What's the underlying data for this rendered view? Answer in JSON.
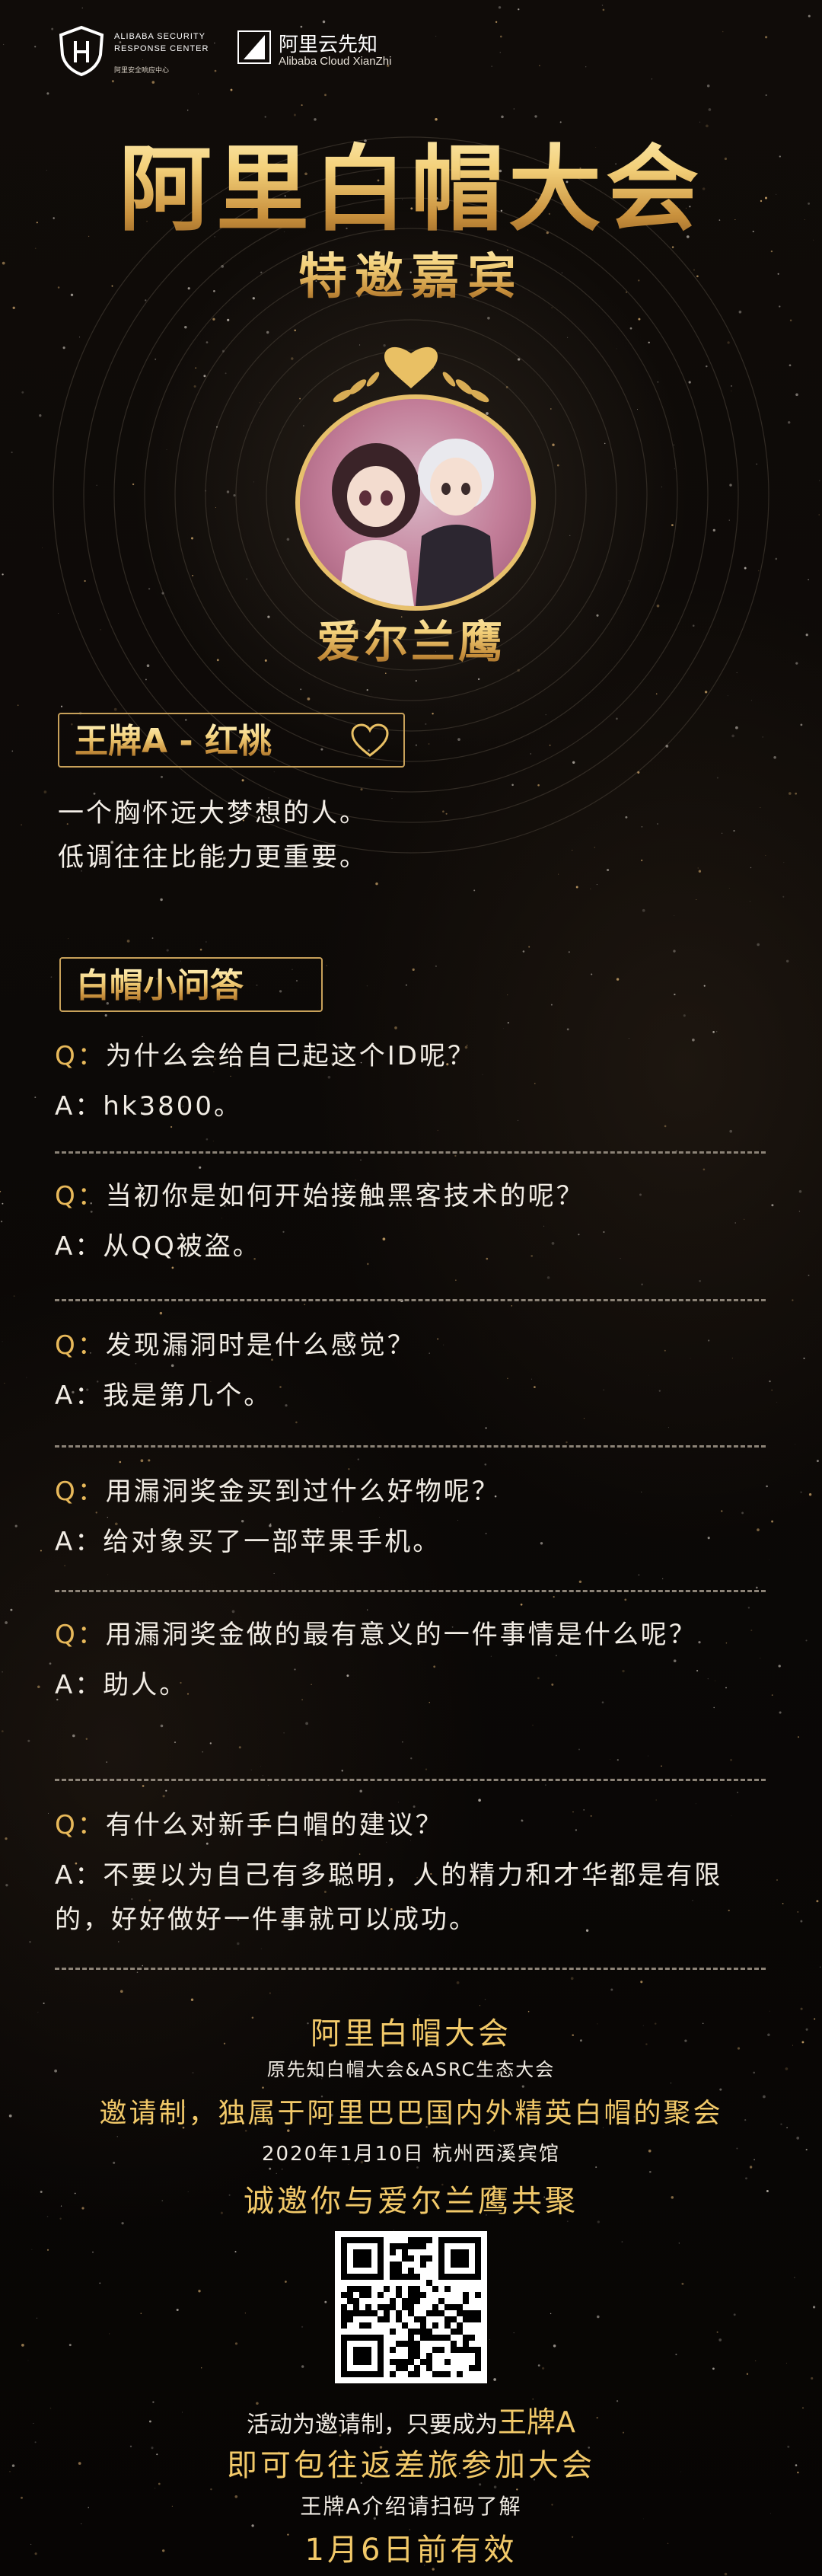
{
  "header": {
    "logo1_lines": [
      "ALIBABA SECURITY",
      "RESPONSE CENTER"
    ],
    "logo1_cn": "阿里安全响应中心",
    "logo2_cn": "阿里云先知",
    "logo2_en": "Alibaba Cloud XianZhi"
  },
  "title": "阿里白帽大会",
  "subtitle": "特邀嘉宾",
  "guest_name": "爱尔兰鹰",
  "tag1": {
    "label": "王牌A - 红桃",
    "icon": "heart-outline-icon"
  },
  "intro": [
    "一个胸怀远大梦想的人。",
    "低调往往比能力更重要。"
  ],
  "tag2": {
    "label": "白帽小问答"
  },
  "qa": [
    {
      "q_prefix": "Q：",
      "q": "为什么会给自己起这个ID呢？",
      "a_prefix": "A：",
      "a": "hk3800。"
    },
    {
      "q_prefix": "Q：",
      "q": "当初你是如何开始接触黑客技术的呢？",
      "a_prefix": "A：",
      "a": "从QQ被盗。"
    },
    {
      "q_prefix": "Q：",
      "q": "发现漏洞时是什么感觉？",
      "a_prefix": "A：",
      "a": "我是第几个。"
    },
    {
      "q_prefix": "Q：",
      "q": "用漏洞奖金买到过什么好物呢？",
      "a_prefix": "A：",
      "a": "给对象买了一部苹果手机。"
    },
    {
      "q_prefix": "Q：",
      "q": "用漏洞奖金做的最有意义的一件事情是什么呢？",
      "a_prefix": "A：",
      "a": "助人。"
    },
    {
      "q_prefix": "Q：",
      "q": "有什么对新手白帽的建议？",
      "a_prefix": "A：",
      "a": "不要以为自己有多聪明，人的精力和才华都是有限的，好好做好一件事就可以成功。"
    }
  ],
  "footer": {
    "event": "阿里白帽大会",
    "event_sub": "原先知白帽大会&ASRC生态大会",
    "invite_line": "邀请制，独属于阿里巴巴国内外精英白帽的聚会",
    "date_place": "2020年1月10日 杭州西溪宾馆",
    "invite_you": "诚邀你与爱尔兰鹰共聚",
    "qr_icon": "qr-code-icon",
    "note_prefix": "活动为邀请制，只要成为",
    "note_highlight": "王牌A",
    "travel": "即可包往返差旅参加大会",
    "scan": "王牌A介绍请扫码了解",
    "valid": "1月6日前有效"
  },
  "colors": {
    "gold": "#f2c969",
    "q_prefix": "#e7b85a",
    "background": "#0c0907"
  }
}
